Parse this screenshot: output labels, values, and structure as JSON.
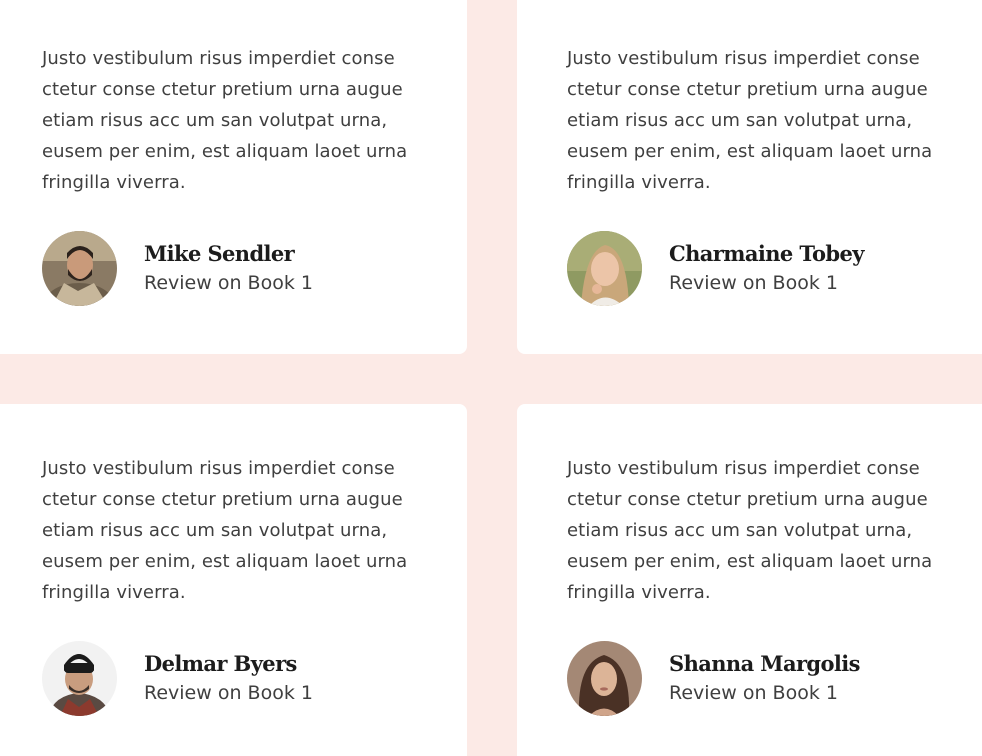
{
  "testimonials": [
    {
      "text": "Justo vestibulum risus imperdiet conse ctetur conse ctetur pretium urna augue etiam risus acc um san volutpat urna, eusem per enim, est aliquam laoet urna fringilla viverra.",
      "name": "Mike Sendler",
      "review_on": "Review on Book 1"
    },
    {
      "text": "Justo vestibulum risus imperdiet conse ctetur conse ctetur pretium urna augue etiam risus acc um san volutpat urna, eusem per enim, est aliquam laoet urna fringilla viverra.",
      "name": "Charmaine Tobey",
      "review_on": "Review on Book 1"
    },
    {
      "text": "Justo vestibulum risus imperdiet conse ctetur conse ctetur pretium urna augue etiam risus acc um san volutpat urna, eusem per enim, est aliquam laoet urna fringilla viverra.",
      "name": "Delmar Byers",
      "review_on": "Review on Book 1"
    },
    {
      "text": "Justo vestibulum risus imperdiet conse ctetur conse ctetur pretium urna augue etiam risus acc um san volutpat urna, eusem per enim, est aliquam laoet urna fringilla viverra.",
      "name": "Shanna Margolis",
      "review_on": "Review on Book 1"
    }
  ],
  "colors": {
    "background": "#fceae6",
    "card": "#ffffff",
    "name_text": "#1c1c1c",
    "body_text": "#3f3f3f"
  }
}
